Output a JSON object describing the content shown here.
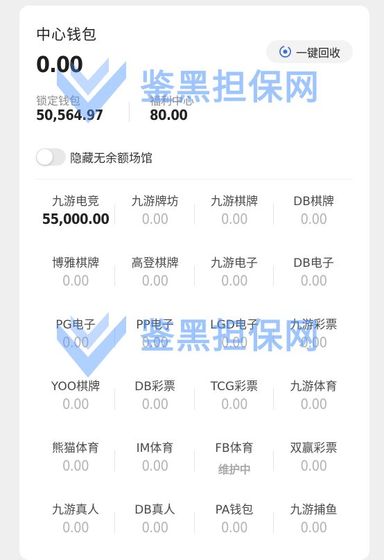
{
  "wallet": {
    "title": "中心钱包",
    "balance": "0.00",
    "recycle_label": "一键回收",
    "locked_label": "锁定钱包",
    "locked_value": "50,564.97",
    "welfare_label": "福利中心",
    "welfare_value": "80.00"
  },
  "toggle": {
    "label": "隐藏无余额场馆",
    "on": false
  },
  "venues": [
    {
      "name": "九游电竞",
      "value": "55,000.00",
      "state": "active"
    },
    {
      "name": "九游牌坊",
      "value": "0.00",
      "state": "zero"
    },
    {
      "name": "九游棋牌",
      "value": "0.00",
      "state": "zero"
    },
    {
      "name": "DB棋牌",
      "value": "0.00",
      "state": "zero"
    },
    {
      "name": "博雅棋牌",
      "value": "0.00",
      "state": "zero"
    },
    {
      "name": "高登棋牌",
      "value": "0.00",
      "state": "zero"
    },
    {
      "name": "九游电子",
      "value": "0.00",
      "state": "zero"
    },
    {
      "name": "DB电子",
      "value": "0.00",
      "state": "zero"
    },
    {
      "name": "PG电子",
      "value": "0.00",
      "state": "zero"
    },
    {
      "name": "PP电子",
      "value": "0.00",
      "state": "zero"
    },
    {
      "name": "LGD电子",
      "value": "0.00",
      "state": "zero"
    },
    {
      "name": "九游彩票",
      "value": "0.00",
      "state": "zero"
    },
    {
      "name": "YOO棋牌",
      "value": "0.00",
      "state": "zero"
    },
    {
      "name": "DB彩票",
      "value": "0.00",
      "state": "zero"
    },
    {
      "name": "TCG彩票",
      "value": "0.00",
      "state": "zero"
    },
    {
      "name": "九游体育",
      "value": "0.00",
      "state": "zero"
    },
    {
      "name": "熊猫体育",
      "value": "0.00",
      "state": "zero"
    },
    {
      "name": "IM体育",
      "value": "0.00",
      "state": "zero"
    },
    {
      "name": "FB体育",
      "value": "维护中",
      "state": "maintenance"
    },
    {
      "name": "双赢彩票",
      "value": "0.00",
      "state": "zero"
    },
    {
      "name": "九游真人",
      "value": "0.00",
      "state": "zero"
    },
    {
      "name": "DB真人",
      "value": "0.00",
      "state": "zero"
    },
    {
      "name": "PA钱包",
      "value": "0.00",
      "state": "zero"
    },
    {
      "name": "九游捕鱼",
      "value": "0.00",
      "state": "zero"
    }
  ],
  "watermark": {
    "text": "鉴黑担保网",
    "color": "#5096ff"
  }
}
